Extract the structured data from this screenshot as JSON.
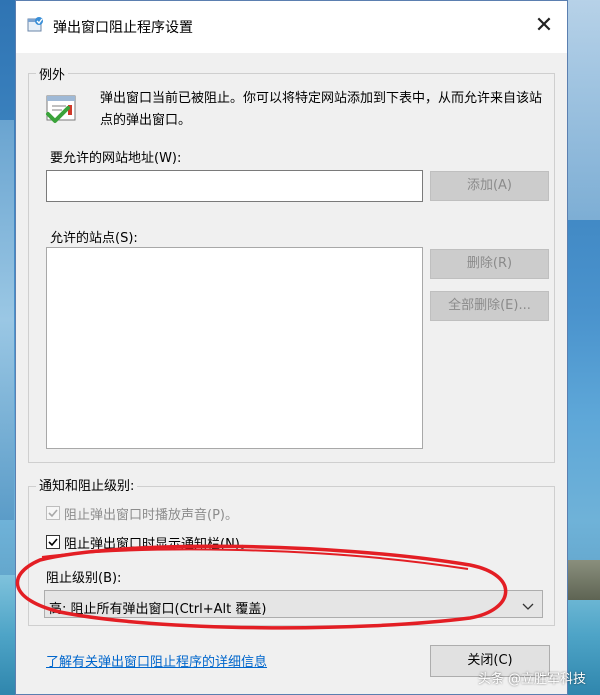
{
  "window": {
    "title": "弹出窗口阻止程序设置"
  },
  "exceptions": {
    "legend": "例外",
    "description": "弹出窗口当前已被阻止。你可以将特定网站添加到下表中，从而允许来自该站点的弹出窗口。",
    "address_label": "要允许的网站地址(W):",
    "address_value": "",
    "add_button": "添加(A)",
    "allowed_label": "允许的站点(S):",
    "allowed_sites": [],
    "remove_button": "删除(R)",
    "remove_all_button": "全部删除(E)..."
  },
  "notifications": {
    "legend": "通知和阻止级别:",
    "play_sound": {
      "label": "阻止弹出窗口时播放声音(P)。",
      "checked": true,
      "enabled": false
    },
    "show_bar": {
      "label": "阻止弹出窗口时显示通知栏(N)。",
      "checked": true,
      "enabled": true
    },
    "level_label": "阻止级别(B):",
    "level_value": "高: 阻止所有弹出窗口(Ctrl+Alt 覆盖)"
  },
  "footer": {
    "learn_more_link": "了解有关弹出窗口阻止程序的详细信息",
    "close_button": "关闭(C)"
  },
  "watermark": "头条 @立胜军科技",
  "colors": {
    "annotation_red": "#e31e24",
    "link_blue": "#0066cc"
  }
}
